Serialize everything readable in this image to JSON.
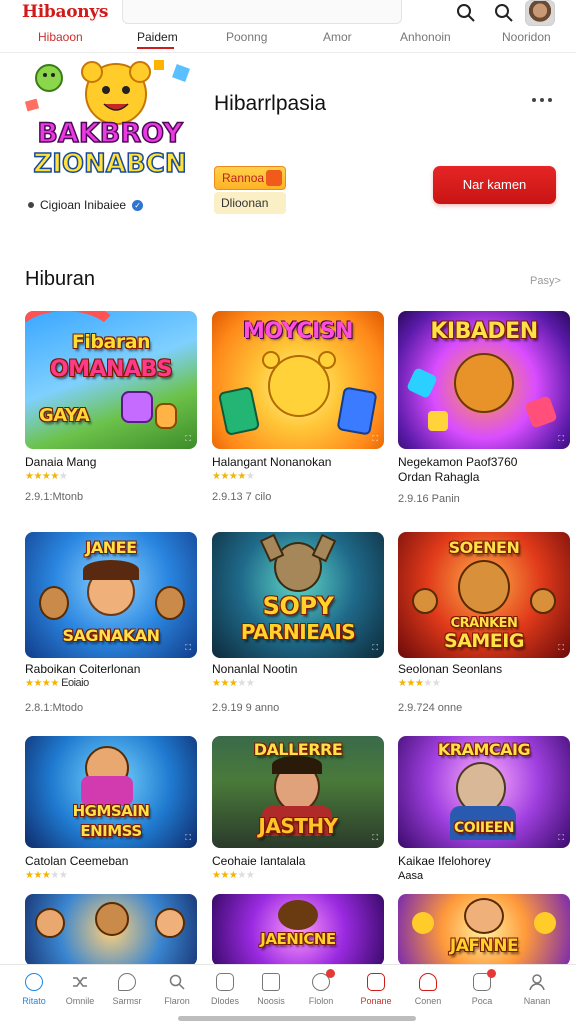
{
  "app": {
    "logo": "Hibaonys"
  },
  "tabs": [
    {
      "label": "Hibaoon"
    },
    {
      "label": "Paidem"
    },
    {
      "label": "Poonng"
    },
    {
      "label": "Amor"
    },
    {
      "label": "Anhonoin"
    },
    {
      "label": "Nooridon"
    }
  ],
  "header": {
    "title": "Hibarrlpasia",
    "art_text_1": "BAKBROY",
    "art_text_2": "ZIONABCN",
    "developer": "Cigioan Inibaiee",
    "badge_primary": "Rannoa",
    "badge_secondary": "Dlioonan",
    "install_label": "Nar kamen"
  },
  "section": {
    "title": "Hiburan",
    "more": "Pasy>"
  },
  "cards": [
    {
      "title": "Danaia Mang",
      "title2": "",
      "stars": 4,
      "extra": "",
      "meta": "2.9.1:Mtonb",
      "art1": "Fibaran",
      "art2": "OMANABS",
      "art3": "GAYA"
    },
    {
      "title": "Halangant Nonanokan",
      "title2": "",
      "stars": 4,
      "extra": "",
      "meta": "2.9.13 7 cilo",
      "art1": "MOYCISN",
      "art2": "",
      "art3": ""
    },
    {
      "title": "Negekamon Paof3760",
      "title2": "Ordan Rahagla",
      "stars": 0,
      "extra": "",
      "meta": "2.9.16 Panin",
      "art1": "KIBADEN",
      "art2": "",
      "art3": ""
    },
    {
      "title": "Raboikan Coiterlonan",
      "title2": "",
      "stars": 4,
      "extra": "Eoiaio",
      "meta": "2.8.1:Mtodo",
      "art1": "JANEE",
      "art2": "SAGNAKAN",
      "art3": ""
    },
    {
      "title": "Nonanlal Nootin",
      "title2": "",
      "stars": 3,
      "extra": "",
      "meta": "2.9.19 9 anno",
      "art1": "SOPY",
      "art2": "PARNIEAIS",
      "art3": ""
    },
    {
      "title": "Seolonan Seonlans",
      "title2": "",
      "stars": 3,
      "extra": "",
      "meta": "2.9.724 onne",
      "art1": "SOENEN",
      "art2": "CRANKEN",
      "art3": "SAMEIG"
    },
    {
      "title": "Catolan Ceemeban",
      "title2": "",
      "stars": 3,
      "extra": "",
      "meta": "",
      "art1": "HGMSAIN",
      "art2": "ENIMSS",
      "art3": ""
    },
    {
      "title": "Ceohaie Iantalala",
      "title2": "",
      "stars": 3,
      "extra": "",
      "meta": "",
      "art1": "DALLERRE",
      "art2": "JASTHY",
      "art3": ""
    },
    {
      "title": "Kaikae Ifelohorey",
      "title2": "Aasa",
      "stars": 0,
      "extra": "",
      "meta": "",
      "art1": "KRAMCAIG",
      "art2": "COIIEEN",
      "art3": ""
    },
    {
      "title": "",
      "title2": "",
      "stars": 0,
      "extra": "",
      "meta": "",
      "art1": "",
      "art2": "",
      "art3": ""
    },
    {
      "title": "",
      "title2": "",
      "stars": 0,
      "extra": "",
      "meta": "",
      "art1": "JAENICNE",
      "art2": "",
      "art3": ""
    },
    {
      "title": "",
      "title2": "",
      "stars": 0,
      "extra": "",
      "meta": "",
      "art1": "JAFNNE",
      "art2": "",
      "art3": ""
    }
  ],
  "bottom_nav": [
    {
      "label": "Ritato"
    },
    {
      "label": "Omnile"
    },
    {
      "label": "Sarmsr"
    },
    {
      "label": "Flaron"
    },
    {
      "label": "Dlodes"
    },
    {
      "label": "Noosis"
    },
    {
      "label": "Flolon"
    },
    {
      "label": "Ponane"
    },
    {
      "label": "Conen"
    },
    {
      "label": "Poca"
    },
    {
      "label": "Nanan"
    }
  ],
  "colors": {
    "accent": "#d11a1a",
    "active_nav": "#1e88e5",
    "star": "#f4b400"
  }
}
